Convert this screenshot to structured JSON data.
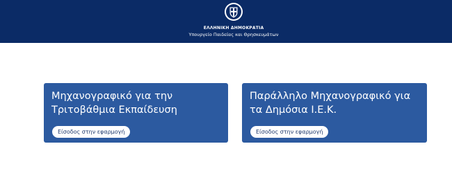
{
  "header": {
    "emblem_icon": "greek-coat-of-arms-icon",
    "government": "ΕΛΛΗΝΙΚΗ ΔΗΜΟΚΡΑΤΙΑ",
    "ministry": "Υπουργείο Παιδείας και Θρησκευμάτων",
    "background_color": "#0b2b66"
  },
  "cards": [
    {
      "title": "Μηχανογραφικό για την Τριτοβάθμια Εκπαίδευση",
      "button_label": "Είσοδος στην εφαρμογή"
    },
    {
      "title": "Παράλληλο Μηχανογραφικό για τα Δημόσια Ι.Ε.Κ.",
      "button_label": "Είσοδος στην εφαρμογή"
    }
  ],
  "colors": {
    "card_background": "#2c5aa0",
    "button_text": "#1f3a6e"
  }
}
